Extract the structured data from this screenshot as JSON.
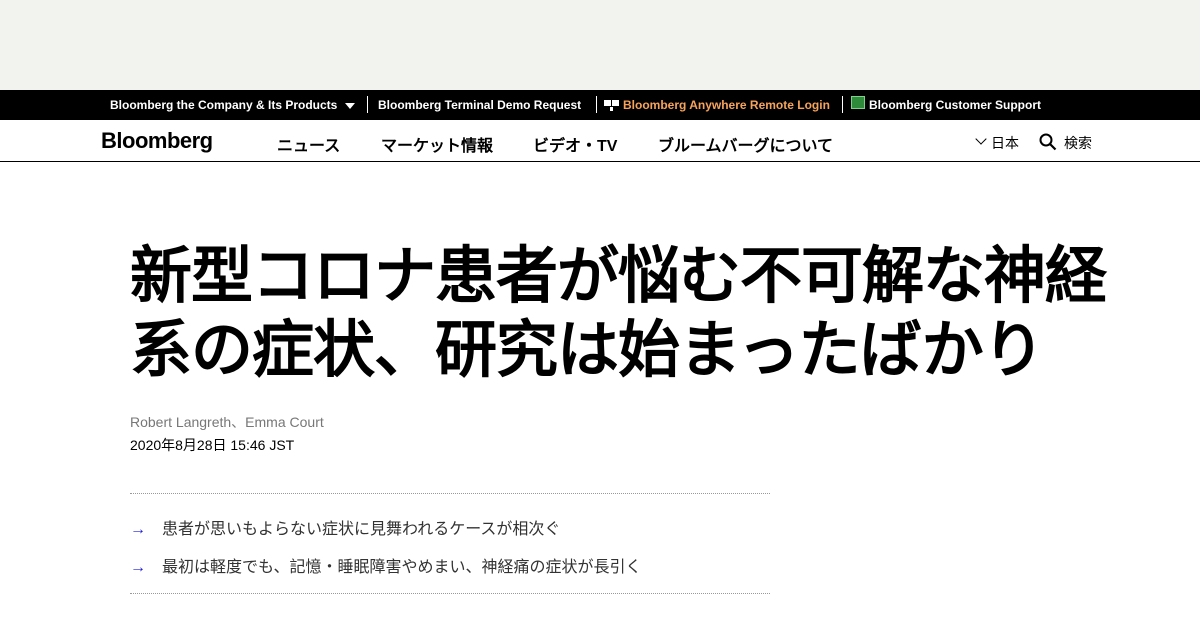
{
  "topbar": {
    "company": "Bloomberg the Company & Its Products",
    "terminal_demo": "Bloomberg Terminal Demo Request",
    "anywhere_login": "Bloomberg Anywhere Remote Login",
    "customer_support": "Bloomberg Customer Support"
  },
  "nav": {
    "logo": "Bloomberg",
    "links": [
      "ニュース",
      "マーケット情報",
      "ビデオ・TV",
      "ブルームバーグについて"
    ],
    "language": "日本",
    "search": "検索"
  },
  "article": {
    "headline_line1": "新型コロナ患者が悩む不可解な神経",
    "headline_line2": "系の症状、研究は始まったばかり",
    "authors": "Robert Langreth、Emma Court",
    "date": "2020年8月28日 15:46 JST",
    "bullets": [
      "患者が思いもよらない症状に見舞われるケースが相次ぐ",
      "最初は軽度でも、記憶・睡眠障害やめまい、神経痛の症状が長引く"
    ],
    "bullet_arrow": "→"
  },
  "colors": {
    "accent_orange": "#f7a35c",
    "arrow_blue": "#1f1fe0",
    "top_bar": "#000000"
  }
}
